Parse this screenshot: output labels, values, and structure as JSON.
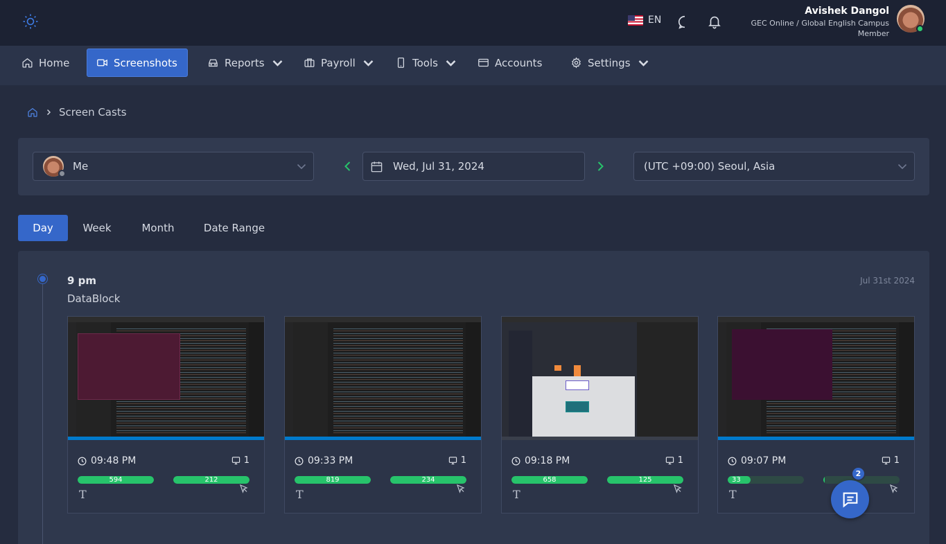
{
  "header": {
    "language": "EN",
    "user_name": "Avishek Dangol",
    "user_org": "GEC Online / Global English Campus",
    "user_role": "Member"
  },
  "nav": {
    "items": [
      {
        "label": "Home",
        "icon": "home-icon"
      },
      {
        "label": "Screenshots",
        "icon": "video-camera-icon"
      },
      {
        "label": "Reports",
        "icon": "reports-icon"
      },
      {
        "label": "Payroll",
        "icon": "briefcase-icon"
      },
      {
        "label": "Tools",
        "icon": "phone-icon"
      },
      {
        "label": "Accounts",
        "icon": "card-icon"
      },
      {
        "label": "Settings",
        "icon": "gear-icon"
      }
    ],
    "active": "Screenshots"
  },
  "breadcrumb": {
    "current": "Screen Casts"
  },
  "filters": {
    "member": "Me",
    "date": "Wed, Jul 31, 2024",
    "timezone": "(UTC +09:00) Seoul, Asia"
  },
  "tabs": [
    "Day",
    "Week",
    "Month",
    "Date Range"
  ],
  "active_tab": "Day",
  "timeline": {
    "time": "9 pm",
    "project": "DataBlock",
    "date": "Jul 31st 2024",
    "cards": [
      {
        "time": "09:48 PM",
        "screens": "1",
        "keyboard": "594",
        "mouse": "212",
        "keyboard_level": 1.0,
        "mouse_level": 1.0
      },
      {
        "time": "09:33 PM",
        "screens": "1",
        "keyboard": "819",
        "mouse": "234",
        "keyboard_level": 1.0,
        "mouse_level": 1.0
      },
      {
        "time": "09:18 PM",
        "screens": "1",
        "keyboard": "658",
        "mouse": "125",
        "keyboard_level": 1.0,
        "mouse_level": 1.0
      },
      {
        "time": "09:07 PM",
        "screens": "1",
        "keyboard": "33",
        "mouse": "",
        "keyboard_level": 0.3,
        "mouse_level": 0.02
      }
    ]
  },
  "chat": {
    "badge": "2"
  },
  "colors": {
    "accent": "#3567c9",
    "activity": "#27c36b",
    "online": "#2ecc71"
  }
}
